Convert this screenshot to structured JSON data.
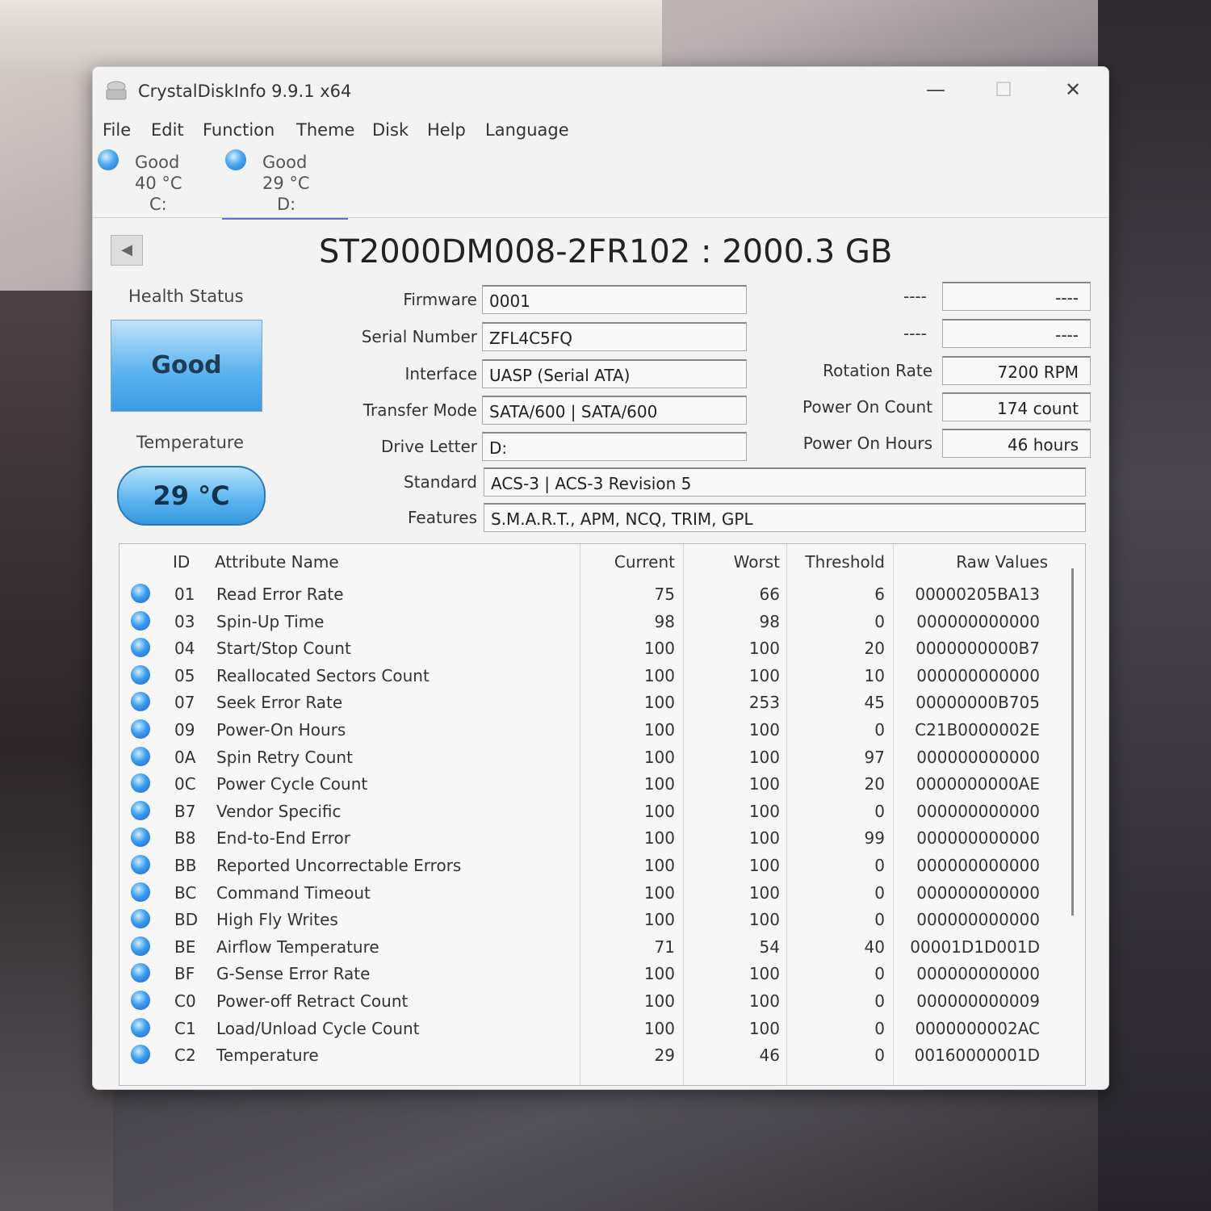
{
  "window": {
    "title": "CrystalDiskInfo 9.9.1 x64",
    "minimize": "—",
    "maximize": "☐",
    "close": "✕"
  },
  "menu": [
    "File",
    "Edit",
    "Function",
    "Theme",
    "Disk",
    "Help",
    "Language"
  ],
  "drives": [
    {
      "status": "Good",
      "temp": "40 °C",
      "letter": "C:"
    },
    {
      "status": "Good",
      "temp": "29 °C",
      "letter": "D:"
    }
  ],
  "disk_title": "ST2000DM008-2FR102 : 2000.3 GB",
  "health": {
    "label": "Health Status",
    "value": "Good"
  },
  "temperature": {
    "label": "Temperature",
    "value": "29 °C"
  },
  "fields": {
    "firmware": {
      "label": "Firmware",
      "value": "0001"
    },
    "serial": {
      "label": "Serial Number",
      "value": "ZFL4C5FQ"
    },
    "interface": {
      "label": "Interface",
      "value": "UASP (Serial ATA)"
    },
    "transfer": {
      "label": "Transfer Mode",
      "value": "SATA/600 | SATA/600"
    },
    "drive_letter": {
      "label": "Drive Letter",
      "value": "D:"
    },
    "standard": {
      "label": "Standard",
      "value": "ACS-3 | ACS-3 Revision 5"
    },
    "features": {
      "label": "Features",
      "value": "S.M.A.R.T., APM, NCQ, TRIM, GPL"
    }
  },
  "right_fields": {
    "blank1": {
      "label": "----",
      "value": "----"
    },
    "blank2": {
      "label": "----",
      "value": "----"
    },
    "rotation": {
      "label": "Rotation Rate",
      "value": "7200 RPM"
    },
    "power_count": {
      "label": "Power On Count",
      "value": "174 count"
    },
    "power_hours": {
      "label": "Power On Hours",
      "value": "46 hours"
    }
  },
  "table": {
    "headers": {
      "id": "ID",
      "name": "Attribute Name",
      "current": "Current",
      "worst": "Worst",
      "threshold": "Threshold",
      "raw": "Raw Values"
    },
    "rows": [
      {
        "id": "01",
        "name": "Read Error Rate",
        "current": "75",
        "worst": "66",
        "threshold": "6",
        "raw": "00000205BA13"
      },
      {
        "id": "03",
        "name": "Spin-Up Time",
        "current": "98",
        "worst": "98",
        "threshold": "0",
        "raw": "000000000000"
      },
      {
        "id": "04",
        "name": "Start/Stop Count",
        "current": "100",
        "worst": "100",
        "threshold": "20",
        "raw": "0000000000B7"
      },
      {
        "id": "05",
        "name": "Reallocated Sectors Count",
        "current": "100",
        "worst": "100",
        "threshold": "10",
        "raw": "000000000000"
      },
      {
        "id": "07",
        "name": "Seek Error Rate",
        "current": "100",
        "worst": "253",
        "threshold": "45",
        "raw": "00000000B705"
      },
      {
        "id": "09",
        "name": "Power-On Hours",
        "current": "100",
        "worst": "100",
        "threshold": "0",
        "raw": "C21B0000002E"
      },
      {
        "id": "0A",
        "name": "Spin Retry Count",
        "current": "100",
        "worst": "100",
        "threshold": "97",
        "raw": "000000000000"
      },
      {
        "id": "0C",
        "name": "Power Cycle Count",
        "current": "100",
        "worst": "100",
        "threshold": "20",
        "raw": "0000000000AE"
      },
      {
        "id": "B7",
        "name": "Vendor Specific",
        "current": "100",
        "worst": "100",
        "threshold": "0",
        "raw": "000000000000"
      },
      {
        "id": "B8",
        "name": "End-to-End Error",
        "current": "100",
        "worst": "100",
        "threshold": "99",
        "raw": "000000000000"
      },
      {
        "id": "BB",
        "name": "Reported Uncorrectable Errors",
        "current": "100",
        "worst": "100",
        "threshold": "0",
        "raw": "000000000000"
      },
      {
        "id": "BC",
        "name": "Command Timeout",
        "current": "100",
        "worst": "100",
        "threshold": "0",
        "raw": "000000000000"
      },
      {
        "id": "BD",
        "name": "High Fly Writes",
        "current": "100",
        "worst": "100",
        "threshold": "0",
        "raw": "000000000000"
      },
      {
        "id": "BE",
        "name": "Airflow Temperature",
        "current": "71",
        "worst": "54",
        "threshold": "40",
        "raw": "00001D1D001D"
      },
      {
        "id": "BF",
        "name": "G-Sense Error Rate",
        "current": "100",
        "worst": "100",
        "threshold": "0",
        "raw": "000000000000"
      },
      {
        "id": "C0",
        "name": "Power-off Retract Count",
        "current": "100",
        "worst": "100",
        "threshold": "0",
        "raw": "000000000009"
      },
      {
        "id": "C1",
        "name": "Load/Unload Cycle Count",
        "current": "100",
        "worst": "100",
        "threshold": "0",
        "raw": "0000000002AC"
      },
      {
        "id": "C2",
        "name": "Temperature",
        "current": "29",
        "worst": "46",
        "threshold": "0",
        "raw": "00160000001D"
      }
    ]
  }
}
